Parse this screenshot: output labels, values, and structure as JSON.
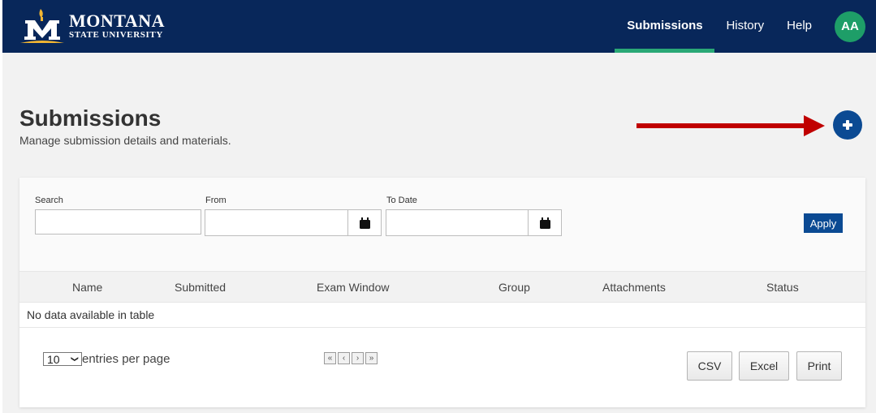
{
  "header": {
    "logo_line1": "MONTANA",
    "logo_line2": "STATE UNIVERSITY",
    "nav": [
      {
        "label": "Submissions",
        "active": true
      },
      {
        "label": "History",
        "active": false
      },
      {
        "label": "Help",
        "active": false
      }
    ],
    "avatar_initials": "AA"
  },
  "page": {
    "title": "Submissions",
    "subtitle": "Manage submission details and materials.",
    "add_button_icon": "plus-icon"
  },
  "filters": {
    "search_label": "Search",
    "search_value": "",
    "from_label": "From",
    "from_value": "",
    "to_label": "To Date",
    "to_value": "",
    "calendar_icon": "calendar-icon",
    "apply_label": "Apply"
  },
  "table": {
    "columns": [
      "Name",
      "Submitted",
      "Exam Window",
      "Group",
      "Attachments",
      "Status"
    ],
    "rows": [],
    "empty_message": "No data available in table"
  },
  "footer": {
    "page_length": "10",
    "entries_label": "entries per page",
    "pager": [
      "«",
      "‹",
      "›",
      "»"
    ],
    "export_buttons": [
      "CSV",
      "Excel",
      "Print"
    ]
  },
  "colors": {
    "header_bg": "#08275a",
    "active_underline": "#2aa876",
    "avatar_bg": "#1e9e68",
    "primary": "#0b4a93",
    "annotation_arrow": "#c00000"
  }
}
